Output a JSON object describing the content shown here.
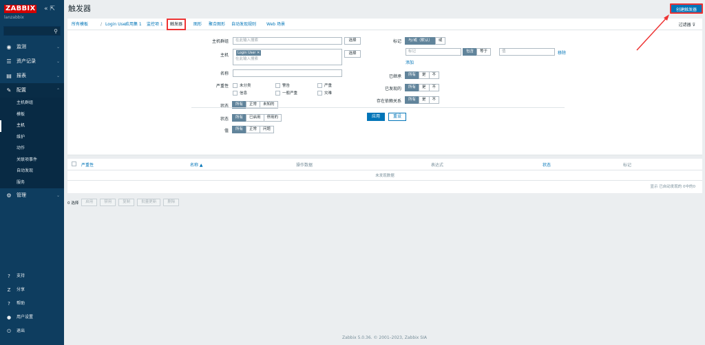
{
  "sidebar": {
    "logo": "ZABBIX",
    "collapse_icon": "«",
    "expand_icon": "⇱",
    "server_name": "lanzabbix",
    "menu": [
      {
        "label": "监测",
        "icon": "eye-icon",
        "glyph": "◉"
      },
      {
        "label": "资产记录",
        "icon": "list-icon",
        "glyph": "☰"
      },
      {
        "label": "报表",
        "icon": "report-icon",
        "glyph": "▤"
      },
      {
        "label": "配置",
        "icon": "wrench-icon",
        "glyph": "🔧"
      },
      {
        "label": "管理",
        "icon": "gear-icon",
        "glyph": "⚙"
      }
    ],
    "config_sub": [
      "主机群组",
      "模板",
      "主机",
      "维护",
      "动作",
      "关联项事件",
      "自动发现",
      "服务"
    ],
    "bottom": [
      {
        "label": "支持",
        "glyph": "?"
      },
      {
        "label": "分享",
        "glyph": "Z"
      },
      {
        "label": "帮助",
        "glyph": "?"
      },
      {
        "label": "用户设置",
        "glyph": "●"
      },
      {
        "label": "退出",
        "glyph": "⏻"
      }
    ]
  },
  "page": {
    "title": "触发器",
    "create_button": "创建触发器"
  },
  "tabs": [
    "所有模板",
    "Login User",
    "应用集 1",
    "监控项 1",
    "触发器",
    "图形",
    "聚合图形",
    "自动发现规则",
    "Web 场景"
  ],
  "filter_toggle": "过滤器",
  "filter": {
    "host_group_label": "主机群组",
    "host_group_placeholder": "在此输入搜索",
    "select": "选择",
    "host_label": "主机",
    "host_tag": "Login User",
    "host_placeholder": "在此输入搜索",
    "name_label": "名称",
    "severity_label": "严重性",
    "severities": [
      "未分类",
      "警告",
      "严重",
      "信息",
      "一般严重",
      "灾难"
    ],
    "state_label": "状态",
    "state_options": [
      "所有",
      "正常",
      "未知的"
    ],
    "status_label": "状态",
    "status_options": [
      "所有",
      "已启用",
      "停用的"
    ],
    "value_label": "值",
    "value_options": [
      "所有",
      "正常",
      "问题"
    ],
    "tags_label": "标记",
    "tags_mode": [
      "与/或（默认）",
      "或"
    ],
    "tag_placeholder": "标记",
    "tag_operators": [
      "包含",
      "等于"
    ],
    "value_placeholder": "值",
    "remove": "移除",
    "add": "添加",
    "inherited_label": "已继承",
    "discovered_label": "已发现的",
    "dependency_label": "存在依赖关系",
    "yesno": [
      "所有",
      "是",
      "不"
    ],
    "apply": "应用",
    "reset": "重设"
  },
  "table": {
    "columns": [
      "严重性",
      "名称 ▲",
      "操作数据",
      "表达式",
      "状态",
      "标记"
    ],
    "empty": "未发现数据",
    "paging": "显示 已自动发现的 0中的0"
  },
  "actions": {
    "selected": "0 选择",
    "buttons": [
      "启用",
      "禁用",
      "复制",
      "批量更新",
      "删除"
    ]
  },
  "footer": "Zabbix 5.0.36. © 2001–2023, Zabbix SIA"
}
